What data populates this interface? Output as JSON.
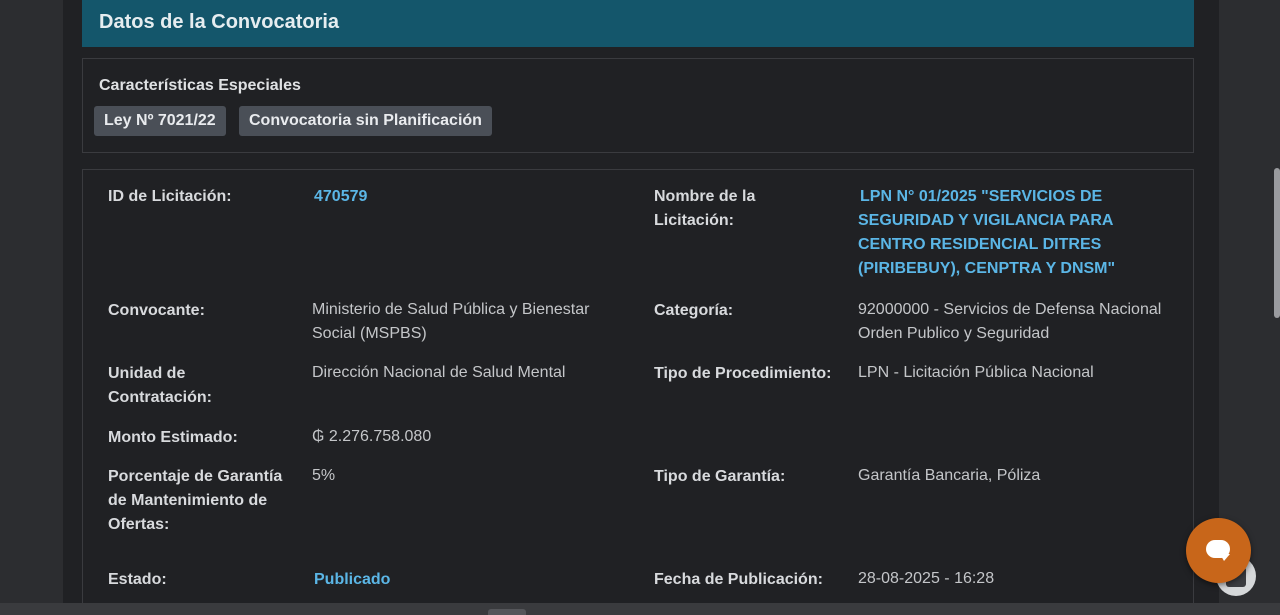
{
  "header": {
    "title": "Datos de la Convocatoria"
  },
  "special": {
    "title": "Características Especiales",
    "badges": [
      "Ley Nº 7021/22",
      "Convocatoria sin Planificación"
    ]
  },
  "details": {
    "id_label": "ID de Licitación:",
    "id_value": "470579",
    "nombre_label_1": "Nombre de la",
    "nombre_label_2": "Licitación:",
    "nombre_lines": [
      "LPN N° 01/2025 \"SERVICIOS DE",
      "SEGURIDAD Y VIGILANCIA PARA",
      "CENTRO RESIDENCIAL DITRES",
      "(PIRIBEBUY), CENPTRA Y DNSM\""
    ],
    "convocante_label": "Convocante:",
    "convocante_lines": [
      "Ministerio de Salud Pública y Bienestar",
      "Social (MSPBS)"
    ],
    "categoria_label": "Categoría:",
    "categoria_lines": [
      "92000000 - Servicios de Defensa Nacional",
      "Orden Publico y Seguridad"
    ],
    "unidad_label_1": "Unidad de",
    "unidad_label_2": "Contratación:",
    "unidad_value": "Dirección Nacional de Salud Mental",
    "tipo_proc_label": "Tipo de Procedimiento:",
    "tipo_proc_value": "LPN - Licitación Pública Nacional",
    "monto_label": "Monto Estimado:",
    "monto_value": "₲ 2.276.758.080",
    "porcentaje_label_lines": [
      "Porcentaje de Garantía",
      "de Mantenimiento de",
      "Ofertas:"
    ],
    "porcentaje_value": "5%",
    "tipo_garantia_label": "Tipo de Garantía:",
    "tipo_garantia_value": "Garantía Bancaria, Póliza",
    "estado_label": "Estado:",
    "estado_value": "Publicado",
    "fecha_label": "Fecha de Publicación:",
    "fecha_value": "28-08-2025 - 16:28"
  },
  "icons": {
    "chat": "chat-bubble-icon",
    "helper": "accessibility-icon"
  },
  "colors": {
    "header_bg": "#14566b",
    "link": "#5bb6e6",
    "chat_button": "#c8661a",
    "badge_bg": "#4a4f57"
  }
}
